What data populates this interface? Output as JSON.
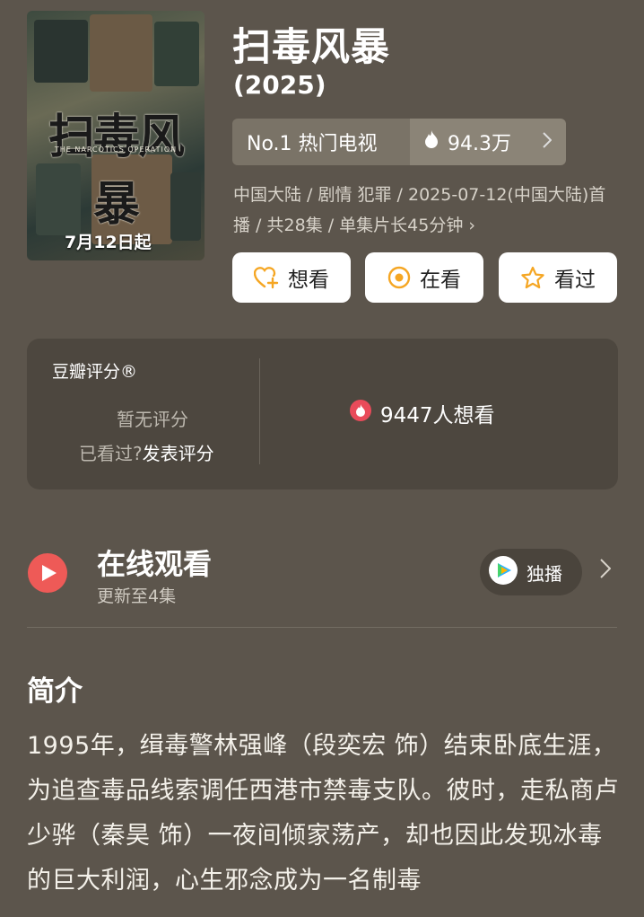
{
  "poster": {
    "title_art": "扫毒风暴",
    "subtitle_art": "THE NARCOTICS OPERATION",
    "date_art": "7月12日起"
  },
  "header": {
    "title": "扫毒风暴",
    "year": "(2025)"
  },
  "ranking": {
    "rank_label": "No.1 热门电视",
    "heat_value": "94.3万",
    "flame_icon": "flame-icon",
    "chevron_icon": "chevron-right-icon"
  },
  "meta": {
    "text": "中国大陆 / 剧情 犯罪 / 2025-07-12(中国大陆)首播 / 共28集 / 单集片长45分钟 ›"
  },
  "actions": {
    "want_label": "想看",
    "watching_label": "在看",
    "watched_label": "看过",
    "accent_color": "#f5a623"
  },
  "rating": {
    "label": "豆瓣评分®",
    "no_rating": "暂无评分",
    "prompt_prefix": "已看过?",
    "prompt_link": "发表评分",
    "want_count": "9447人想看",
    "badge_color": "#e94b5a"
  },
  "online": {
    "title": "在线观看",
    "subtitle": "更新至4集",
    "exclusive_label": "独播",
    "play_color": "#ee5a57"
  },
  "intro": {
    "title": "简介",
    "text": "1995年，缉毒警林强峰（段奕宏 饰）结束卧底生涯，为追查毒品线索调任西港市禁毒支队。彼时，走私商卢少骅（秦昊 饰）一夜间倾家荡产，却也因此发现冰毒的巨大利润，心生邪念成为一名制毒"
  }
}
